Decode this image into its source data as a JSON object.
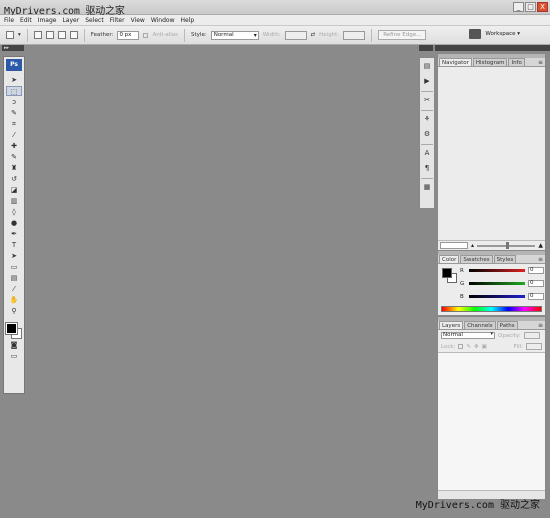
{
  "watermark": "MyDrivers.com 驱动之家",
  "window": {
    "min": "_",
    "max": "□",
    "close": "X"
  },
  "menu": [
    "File",
    "Edit",
    "Image",
    "Layer",
    "Select",
    "Filter",
    "View",
    "Window",
    "Help"
  ],
  "options": {
    "feather_label": "Feather:",
    "feather_value": "0 px",
    "antialias_label": "Anti-alias",
    "style_label": "Style:",
    "style_value": "Normal",
    "width_label": "Width:",
    "height_label": "Height:",
    "refine_edge": "Refine Edge..."
  },
  "workspace_label": "Workspace ▾",
  "toolbox": {
    "logo": "Ps",
    "tools": [
      {
        "name": "move-tool",
        "glyph": "➤"
      },
      {
        "name": "marquee-tool",
        "glyph": "⬚"
      },
      {
        "name": "lasso-tool",
        "glyph": "ↄ"
      },
      {
        "name": "quick-select-tool",
        "glyph": "✎"
      },
      {
        "name": "crop-tool",
        "glyph": "⌗"
      },
      {
        "name": "slice-tool",
        "glyph": "⁄"
      },
      {
        "name": "healing-brush-tool",
        "glyph": "✚"
      },
      {
        "name": "brush-tool",
        "glyph": "✎"
      },
      {
        "name": "clone-stamp-tool",
        "glyph": "♜"
      },
      {
        "name": "history-brush-tool",
        "glyph": "↺"
      },
      {
        "name": "eraser-tool",
        "glyph": "◪"
      },
      {
        "name": "gradient-tool",
        "glyph": "▥"
      },
      {
        "name": "blur-tool",
        "glyph": "◊"
      },
      {
        "name": "dodge-tool",
        "glyph": "●"
      },
      {
        "name": "pen-tool",
        "glyph": "✒"
      },
      {
        "name": "type-tool",
        "glyph": "T"
      },
      {
        "name": "path-select-tool",
        "glyph": "➤"
      },
      {
        "name": "shape-tool",
        "glyph": "▭"
      },
      {
        "name": "notes-tool",
        "glyph": "▤"
      },
      {
        "name": "eyedropper-tool",
        "glyph": "⁄"
      },
      {
        "name": "hand-tool",
        "glyph": "✋"
      },
      {
        "name": "zoom-tool",
        "glyph": "⚲"
      }
    ]
  },
  "midpanel_icons": [
    "▤",
    "▶",
    "✂",
    "⚘",
    "⚙",
    "A",
    "¶",
    "▦"
  ],
  "navigator": {
    "tabs": [
      "Navigator",
      "Histogram",
      "Info"
    ],
    "menu": "≡"
  },
  "color": {
    "tabs": [
      "Color",
      "Swatches",
      "Styles"
    ],
    "channels": [
      {
        "letter": "R",
        "value": "0",
        "color": "#d22"
      },
      {
        "letter": "G",
        "value": "0",
        "color": "#2a2"
      },
      {
        "letter": "B",
        "value": "0",
        "color": "#22c"
      }
    ]
  },
  "layers": {
    "tabs": [
      "Layers",
      "Channels",
      "Paths"
    ],
    "blend_mode": "Normal",
    "opacity_label": "Opacity:",
    "lock_label": "Lock:",
    "fill_label": "Fill:"
  }
}
